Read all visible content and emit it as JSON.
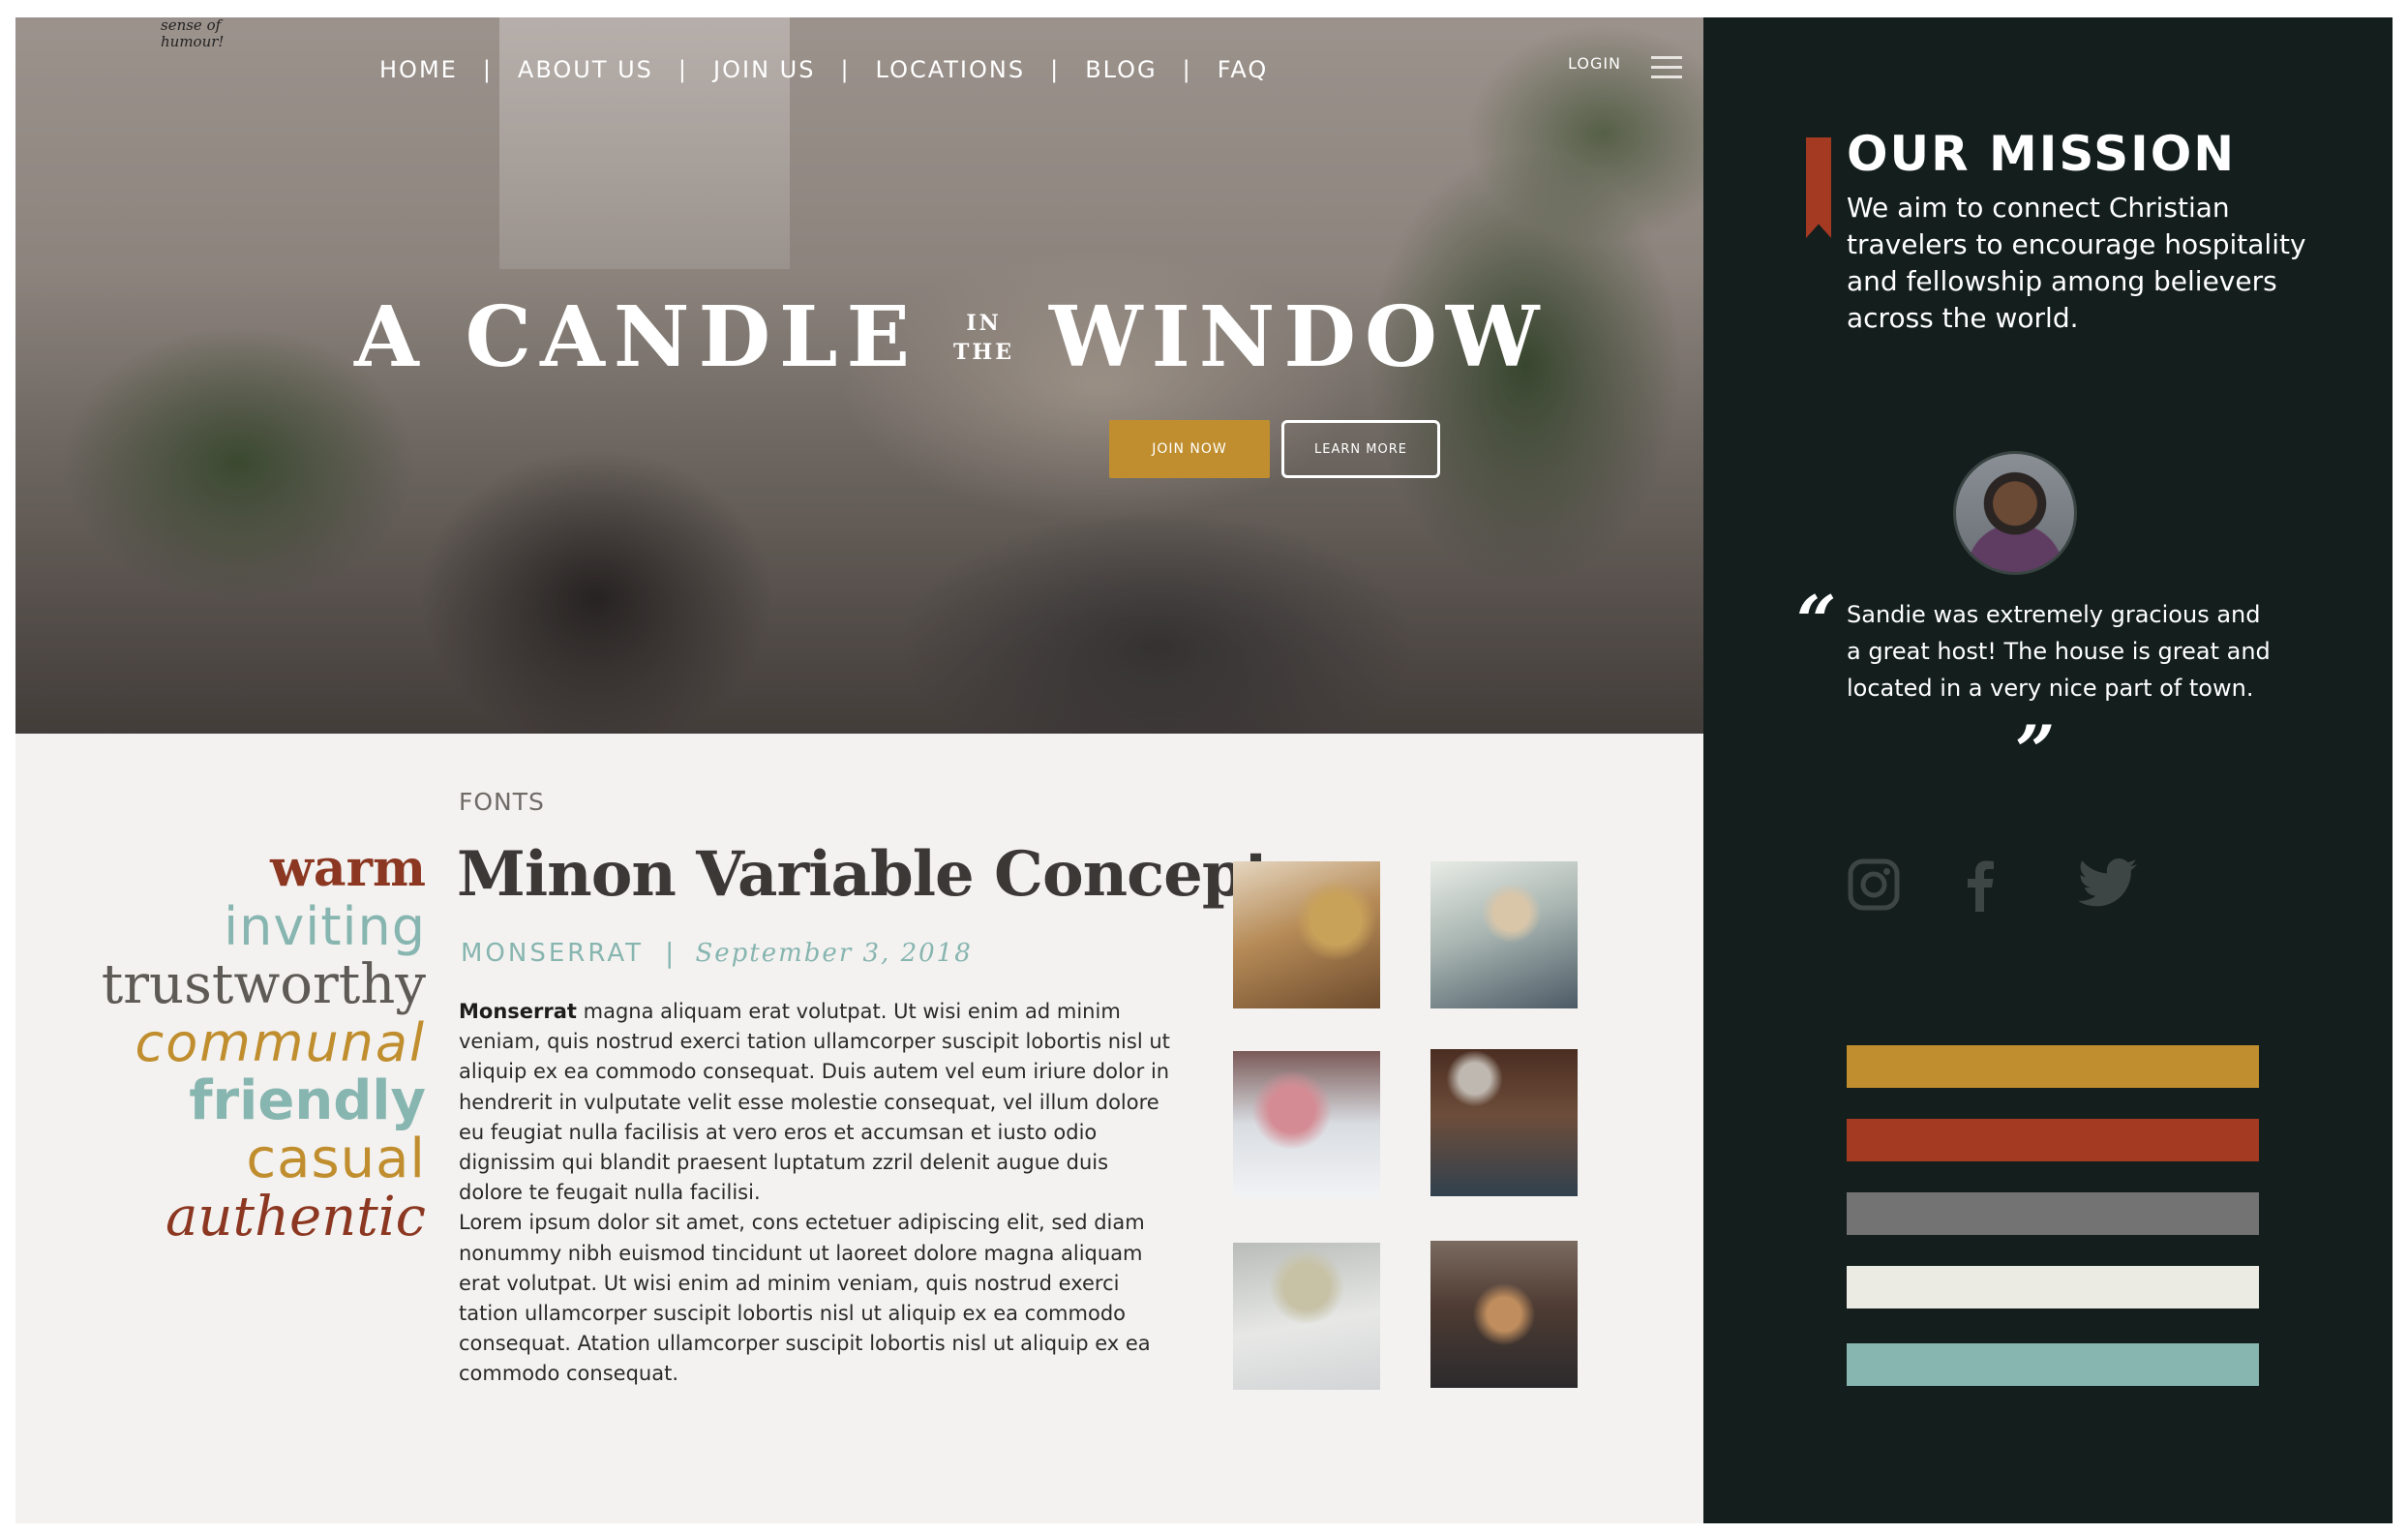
{
  "nav": {
    "items": [
      "HOME",
      "ABOUT US",
      "JOIN US",
      "LOCATIONS",
      "BLOG",
      "FAQ"
    ],
    "separator": "|",
    "login": "LOGIN"
  },
  "hero": {
    "sign_text": "sense of humour!",
    "title_part1": "A CANDLE",
    "title_small_top": "IN",
    "title_small_bottom": "THE",
    "title_part2": "WINDOW",
    "join_button": "JOIN  NOW",
    "learn_button": "LEARN MORE"
  },
  "adjectives": [
    "warm",
    "inviting",
    "trustworthy",
    "communal",
    "friendly",
    "casual",
    "authentic"
  ],
  "fonts": {
    "label": "FONTS",
    "title": "Minon Variable Concept",
    "meta_font": "MONSERRAT",
    "meta_separator": "|",
    "date": "September 3, 2018",
    "body_lead": "Monserrat",
    "body_para1": " magna aliquam erat volutpat. Ut wisi enim ad minim veniam, quis nostrud exerci tation ullamcorper suscipit lobortis nisl ut aliquip ex ea commodo consequat. Duis autem vel eum iriure dolor in hendrerit in vulputate velit esse molestie consequat, vel illum dolore eu feugiat nulla facilisis at vero eros et accumsan et iusto odio dignissim qui blandit praesent luptatum zzril delenit augue duis dolore te feugait nulla facilisi.",
    "body_para2": "Lorem ipsum dolor sit amet, cons ectetuer adipiscing elit, sed diam nonummy nibh euismod tincidunt ut laoreet dolore magna aliquam erat volutpat. Ut wisi enim ad minim veniam, quis nostrud exerci tation ullamcorper suscipit lobortis nisl ut aliquip ex ea commodo consequat. Atation ullamcorper suscipit lobortis nisl ut aliquip ex ea commodo consequat."
  },
  "mission": {
    "title": "OUR MISSION",
    "text": "We aim to connect Christian travelers to encourage hospitality and fellowship among believers across the world."
  },
  "testimonial": {
    "open_quote": "“",
    "text": "Sandie was extremely gracious and a great host! The house is great and located in a very nice part of town.",
    "close_quote": "”"
  },
  "social": [
    "instagram-icon",
    "facebook-icon",
    "twitter-icon"
  ],
  "palette": [
    "#c08e2e",
    "#a53a22",
    "#747373",
    "#ebeae3",
    "#87b5b0"
  ]
}
